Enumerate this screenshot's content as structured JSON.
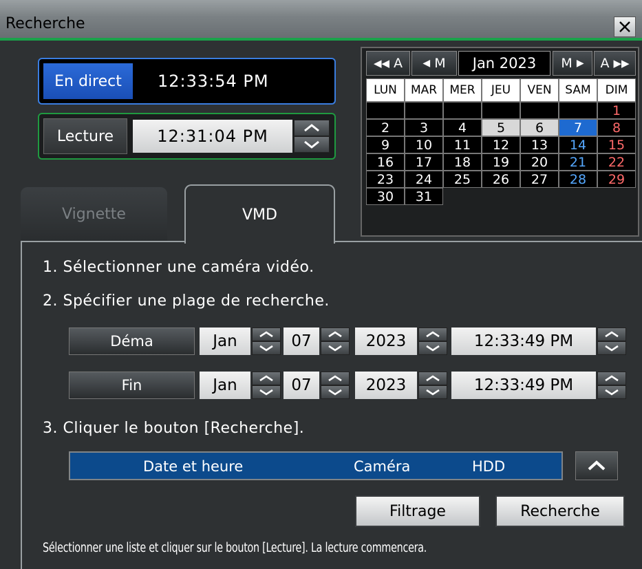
{
  "window": {
    "title": "Recherche",
    "close_icon": "close-icon"
  },
  "live": {
    "label": "En direct",
    "time": "12:33:54 PM"
  },
  "playback": {
    "label": "Lecture",
    "time": "12:31:04 PM"
  },
  "calendar": {
    "nav": {
      "prev_year": "A",
      "prev_month": "M",
      "next_month": "M",
      "next_year": "A"
    },
    "month_label": "Jan 2023",
    "weekdays": [
      "LUN",
      "MAR",
      "MER",
      "JEU",
      "VEN",
      "SAM",
      "DIM"
    ],
    "weeks": [
      [
        "",
        "",
        "",
        "",
        "",
        "",
        "1"
      ],
      [
        "2",
        "3",
        "4",
        "5",
        "6",
        "7",
        "8"
      ],
      [
        "9",
        "10",
        "11",
        "12",
        "13",
        "14",
        "15"
      ],
      [
        "16",
        "17",
        "18",
        "19",
        "20",
        "21",
        "22"
      ],
      [
        "23",
        "24",
        "25",
        "26",
        "27",
        "28",
        "29"
      ],
      [
        "30",
        "31",
        "",
        "",
        "",
        "",
        ""
      ]
    ],
    "selected_day": "7",
    "recorded_days": [
      "5",
      "6"
    ],
    "colors": {
      "selected": "#1e6ad0",
      "saturday": "#55a8ff",
      "sunday": "#ff6a6a"
    }
  },
  "tabs": [
    {
      "label": "Vignette",
      "active": false
    },
    {
      "label": "VMD",
      "active": true
    }
  ],
  "steps": {
    "step1": "1. Sélectionner une caméra vidéo.",
    "step2": "2. Spécifier une plage de recherche.",
    "step3": "3. Cliquer le bouton [Recherche]."
  },
  "range": {
    "start": {
      "label": "Déma",
      "month": "Jan",
      "day": "07",
      "year": "2023",
      "time": "12:33:49 PM"
    },
    "end": {
      "label": "Fin",
      "month": "Jan",
      "day": "07",
      "year": "2023",
      "time": "12:33:49 PM"
    }
  },
  "list": {
    "columns": [
      "Date et heure",
      "Caméra",
      "HDD"
    ]
  },
  "buttons": {
    "filter": "Filtrage",
    "search": "Recherche"
  },
  "footer_note": "Sélectionner une liste et cliquer sur le bouton [Lecture]. La lecture commencera.",
  "accent": {
    "green": "#1aa24a",
    "blue": "#3a7de0",
    "list_bg": "#0c4a8c"
  }
}
